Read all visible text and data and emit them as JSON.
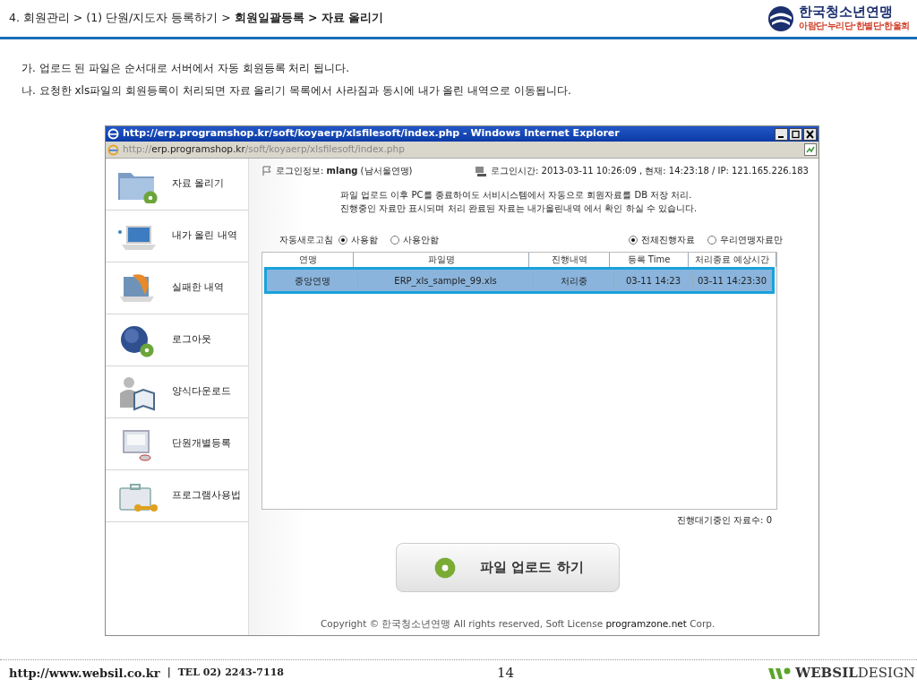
{
  "breadcrumb": "4. 회원관리 > (1) 단원/지도자 등록하기 > **회원일괄등록 > 자료 올리기**",
  "logo": {
    "name": "한국청소년연맹",
    "subtitle": "아람단·누리단·한별단·한울회"
  },
  "notes": [
    "가. 업로드 된 파일은 순서대로 서버에서 자동 회원등록 처리 됩니다.",
    "나. 요청한 xls파일의 회원등록이 처리되면 자료 올리기 목록에서 사라짐과 동시에 내가 올린 내역으로 이동됩니다."
  ],
  "window": {
    "title": "http://erp.programshop.kr/soft/koyaerp/xlsfilesoft/index.php - Windows Internet Explorer",
    "address": "http://**erp.programshop.kr**/soft/koyaerp/xlsfilesoft/index.php"
  },
  "sidebar": {
    "items": [
      {
        "label": "자료 올리기",
        "kind": "folder"
      },
      {
        "label": "내가 올린 내역",
        "kind": "laptop"
      },
      {
        "label": "실패한 내역",
        "kind": "failed"
      },
      {
        "label": "로그아웃",
        "kind": "globe"
      },
      {
        "label": "양식다운로드",
        "kind": "person"
      },
      {
        "label": "단원개별등록",
        "kind": "monitor"
      },
      {
        "label": "프로그램사용법",
        "kind": "briefcase"
      }
    ]
  },
  "login_info": "로그인정보: **mlang** (남서울연맹)",
  "login_time": "로그인시간: 2013-03-11 10:26:09 , 현재: 14:23:18  / IP: 121.165.226.183",
  "description": [
    "파일 업로드 이후 PC를 종료하여도 서비시스템에서 자동으로 회원자료를 DB 저장 처리.",
    "진행중인 자료만 표시되며 처리 완료된 자료는 내가올린내역 에서 확인 하실 수 있습니다."
  ],
  "auto_refresh": {
    "label": "자동새로고침",
    "options": [
      {
        "label": "사용함",
        "selected": true
      },
      {
        "label": "사용안함",
        "selected": false
      }
    ]
  },
  "filter": {
    "options": [
      {
        "label": "전체진행자료",
        "selected": true
      },
      {
        "label": "우리연맹자료만",
        "selected": false
      }
    ]
  },
  "table": {
    "columns": [
      "연맹",
      "파일명",
      "진행내역",
      "등록 Time",
      "처리종료 예상시간"
    ],
    "rows": [
      {
        "cells": [
          "중앙연맹",
          "ERP_xls_sample_99.xls",
          "처리중",
          "03-11 14:23",
          "03-11 14:23:30"
        ],
        "selected": true
      }
    ]
  },
  "queue_count": "진행대기중인 자료수: 0",
  "upload_button": "파일 업로드 하기",
  "copyright": "Copyright © 한국청소년연맹 All rights reserved, Soft License **programzone.net** Corp.",
  "footer": {
    "url": "http://www.websil.co.kr",
    "separator": "|",
    "tel": "TEL 02) 2243-7118",
    "page": "14",
    "brand": "**WEBSIL**DESIGN"
  }
}
